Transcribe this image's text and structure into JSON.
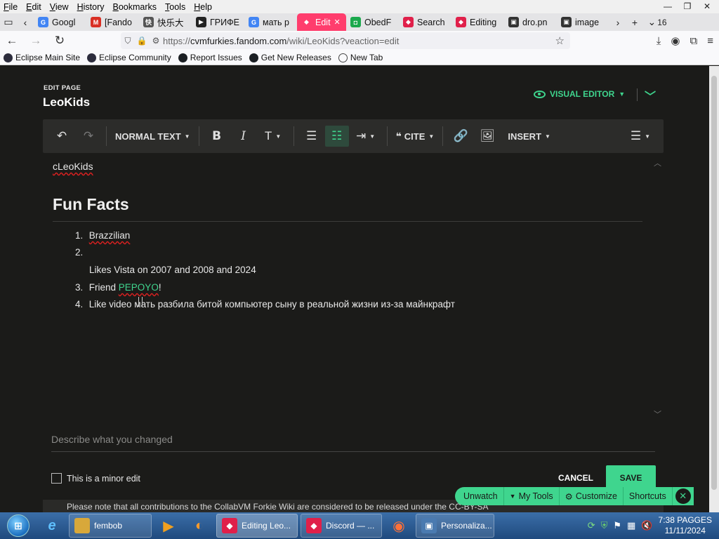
{
  "menubar": {
    "items": [
      {
        "prefix": "F",
        "rest": "ile"
      },
      {
        "prefix": "E",
        "rest": "dit"
      },
      {
        "prefix": "V",
        "rest": "iew"
      },
      {
        "prefix": "H",
        "rest": "istory"
      },
      {
        "prefix": "B",
        "rest": "ookmarks"
      },
      {
        "prefix": "T",
        "rest": "ools"
      },
      {
        "prefix": "H",
        "rest": "elp"
      }
    ]
  },
  "tabs": [
    {
      "label": "Googl",
      "icon": "G",
      "color": "#4285f4"
    },
    {
      "label": "[Fando",
      "icon": "M",
      "color": "#d93025"
    },
    {
      "label": "快乐大",
      "icon": "快",
      "color": "#555"
    },
    {
      "label": "ГРИФЕ",
      "icon": "▶",
      "color": "#222"
    },
    {
      "label": "мать р",
      "icon": "G",
      "color": "#4285f4"
    },
    {
      "label": "Edit",
      "icon": "◆",
      "color": "#ff3d6d",
      "active": true
    },
    {
      "label": "ObedF",
      "icon": "◘",
      "color": "#1aa84c"
    },
    {
      "label": "Search",
      "icon": "◆",
      "color": "#e0204a"
    },
    {
      "label": "Editing",
      "icon": "◆",
      "color": "#e0204a"
    },
    {
      "label": "dro.pn",
      "icon": "▣",
      "color": "#333"
    },
    {
      "label": "image",
      "icon": "▣",
      "color": "#333"
    }
  ],
  "tab_count": "16",
  "url": {
    "prefix": "https://",
    "host": "cvmfurkies.fandom.com",
    "path": "/wiki/LeoKids?veaction=edit"
  },
  "bookmarks": [
    "Eclipse Main Site",
    "Eclipse Community",
    "Report Issues",
    "Get New Releases",
    "New Tab"
  ],
  "editor": {
    "edit_label": "EDIT PAGE",
    "page_title": "LeoKids",
    "visual_editor": "VISUAL EDITOR",
    "toolbar": {
      "normal_text": "NORMAL TEXT",
      "cite": "CITE",
      "insert": "INSERT"
    },
    "content": {
      "first_line": "cLeoKids",
      "heading": "Fun Facts",
      "items": [
        {
          "num": "1.",
          "text": "Brazzilian"
        },
        {
          "num": "2.",
          "text": ""
        },
        {
          "num": "",
          "text": "Likes Vista on 2007 and 2008 and 2024"
        },
        {
          "num": "3.",
          "text_before": "Friend ",
          "link": "PEPOYO",
          "text_after": "!"
        },
        {
          "num": "4.",
          "text": "Like video мать разбила битой компьютер сыну в реальной жизни из-за майнкрафт"
        }
      ]
    },
    "summary_placeholder": "Describe what you changed",
    "minor_edit": "This is a minor edit",
    "cancel": "CANCEL",
    "save": "SAVE",
    "notice": "Please note that all contributions to the CollabVM Forkie Wiki are considered to be released under the CC-BY-SA"
  },
  "toolsbar": {
    "unwatch": "Unwatch",
    "my_tools": "My Tools",
    "customize": "Customize",
    "shortcuts": "Shortcuts"
  },
  "taskbar": {
    "tasks": [
      {
        "label": "fembob",
        "icon": "📁",
        "color": "#d8a83a"
      },
      {
        "label": "Editing Leo...",
        "icon": "◆",
        "color": "#e0204a",
        "active": true
      },
      {
        "label": "Discord — ...",
        "icon": "◆",
        "color": "#e0204a"
      },
      {
        "label": "Personaliza...",
        "icon": "▣",
        "color": "#4a7ab0"
      }
    ],
    "clock_time": "7:38 PAGGES",
    "clock_date": "11/11/2024"
  }
}
